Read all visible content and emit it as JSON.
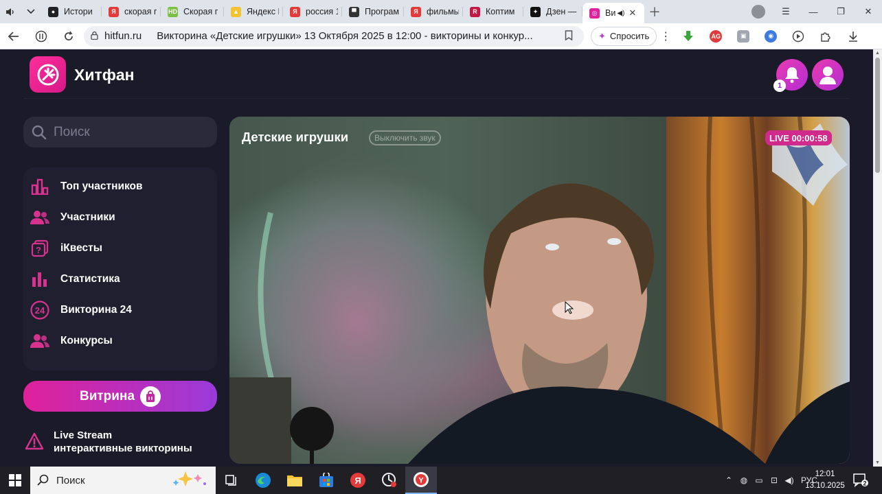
{
  "browser": {
    "tabs": [
      {
        "label": "Истори",
        "color": "#202124",
        "glyph": "●"
      },
      {
        "label": "скорая п",
        "color": "#e33a3a",
        "glyph": "Я"
      },
      {
        "label": "Скорая г",
        "color": "#7bc043",
        "glyph": "HD"
      },
      {
        "label": "Яндекс К",
        "color": "#f2c230",
        "glyph": "▲"
      },
      {
        "label": "россия 1",
        "color": "#e33a3a",
        "glyph": "Я"
      },
      {
        "label": "Програм",
        "color": "#333333",
        "glyph": "▀"
      },
      {
        "label": "фильмы",
        "color": "#e33a3a",
        "glyph": "Я"
      },
      {
        "label": "Коптим",
        "color": "#c21845",
        "glyph": "R"
      },
      {
        "label": "Дзен — т",
        "color": "#111111",
        "glyph": "✦"
      }
    ],
    "active_tab": {
      "label": "Ви",
      "audio": "◀)"
    },
    "url_domain": "hitfun.ru",
    "page_title": "Викторина «Детские игрушки» 13 Октября 2025 в 12:00 - викторины и конкур...",
    "ask_label": "Спросить"
  },
  "site": {
    "brand": "Хитфан",
    "notification_count": "1",
    "search_placeholder": "Поиск",
    "menu": [
      {
        "label": "Топ участников",
        "icon": "top-chart-icon"
      },
      {
        "label": "Участники",
        "icon": "users-icon"
      },
      {
        "label": "iКвесты",
        "icon": "quest-icon"
      },
      {
        "label": "Статистика",
        "icon": "stats-icon"
      },
      {
        "label": "Викторина 24",
        "icon": "quiz-24-icon"
      },
      {
        "label": "Конкурсы",
        "icon": "contests-icon"
      }
    ],
    "vitrina_label": "Витрина",
    "promo_line1": "Live Stream",
    "promo_line2": "интерактивные викторины",
    "accent": "#e0219b"
  },
  "video": {
    "title": "Детские игрушки",
    "mute_label": "Выключить звук",
    "live_label": "LIVE 00:00:58"
  },
  "taskbar": {
    "search_placeholder": "Поиск",
    "language": "РУС",
    "time": "12:01",
    "date": "13.10.2025",
    "notifications": "2"
  }
}
